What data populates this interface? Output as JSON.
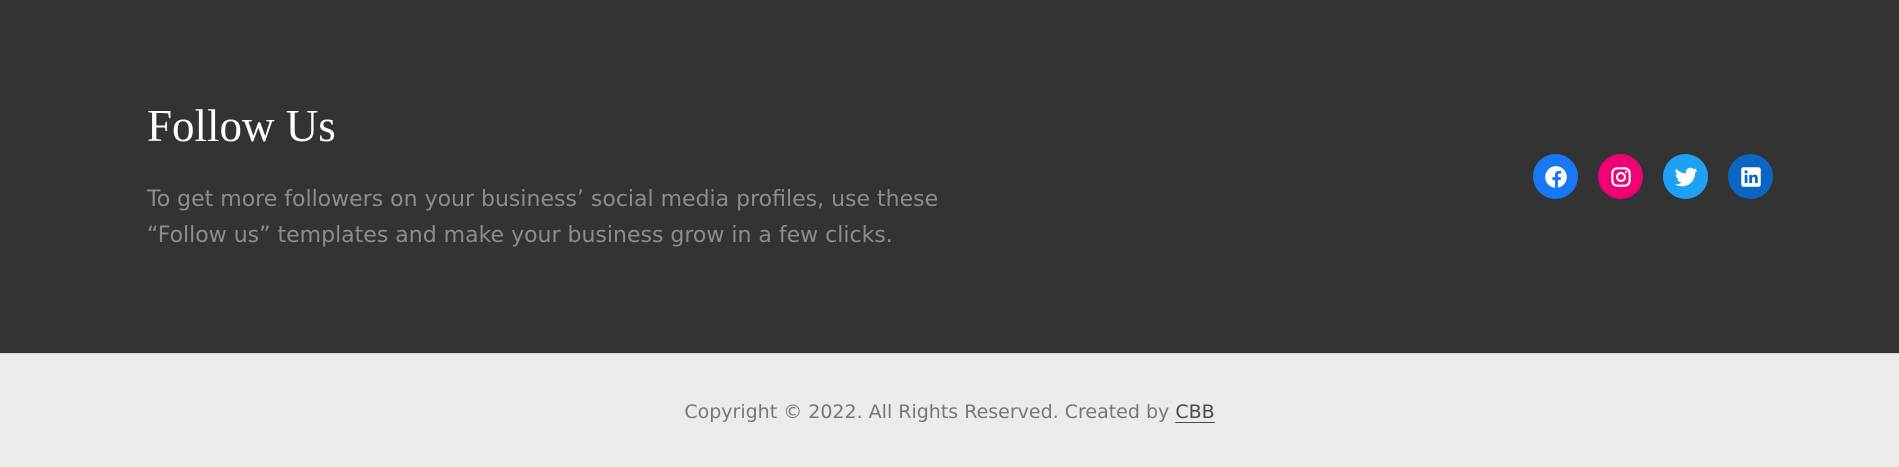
{
  "follow": {
    "title": "Follow Us",
    "description": "To get more followers on your business’ social media profiles, use these “Follow us” templates and make your business grow in a few clicks."
  },
  "social": [
    {
      "name": "Facebook",
      "icon": "facebook-icon",
      "color": "#1877f2"
    },
    {
      "name": "Instagram",
      "icon": "instagram-icon",
      "color": "#f00075"
    },
    {
      "name": "Twitter",
      "icon": "twitter-icon",
      "color": "#1da1f2"
    },
    {
      "name": "LinkedIn",
      "icon": "linkedin-icon",
      "color": "#0a66c2"
    }
  ],
  "footer": {
    "copyright": "Copyright © 2022. All Rights Reserved. Created by ",
    "creator": "CBB"
  }
}
